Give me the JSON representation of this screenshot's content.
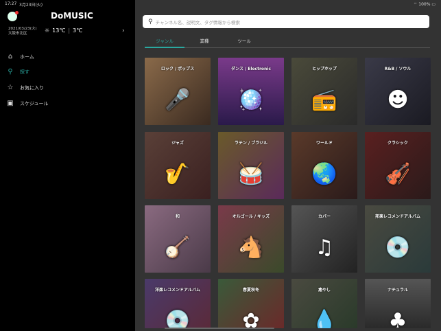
{
  "status": {
    "time": "17:27",
    "date": "3月23日(火)",
    "battery": "100%"
  },
  "app": {
    "title": "DoMUSIC",
    "date": "2021/03/23(火)",
    "location": "大阪市北区",
    "temp_high": "13℃",
    "temp_low": "3℃"
  },
  "nav": [
    {
      "label": "ホーム",
      "icon": "⌂"
    },
    {
      "label": "探す",
      "icon": "⚲"
    },
    {
      "label": "お気に入り",
      "icon": "☆"
    },
    {
      "label": "スケジュール",
      "icon": "▣"
    }
  ],
  "search": {
    "placeholder": "チャンネル名、説明文、タグ情報から検索"
  },
  "tabs": [
    "ジャンル",
    "業種",
    "ツール"
  ],
  "tiles": [
    {
      "label": "ロック / ポップス",
      "icon": "🎤",
      "bg": "linear-gradient(135deg,#8a6a4a,#3a2a20)"
    },
    {
      "label": "ダンス / Electronic",
      "icon": "🪩",
      "bg": "linear-gradient(180deg,#7a3a8a,#2a1a4a)"
    },
    {
      "label": "ヒップホップ",
      "icon": "📻",
      "bg": "linear-gradient(135deg,#4a4a3a,#2a2a2a)"
    },
    {
      "label": "R&B / ソウル",
      "icon": "☻",
      "bg": "linear-gradient(135deg,#3a3a48,#1a1a22)"
    },
    {
      "label": "ジャズ",
      "icon": "🎷",
      "bg": "linear-gradient(135deg,#5a4038,#3a2020)"
    },
    {
      "label": "ラテン / ブラジル",
      "icon": "🥁",
      "bg": "linear-gradient(135deg,#6a5a2a,#5a2a5a)"
    },
    {
      "label": "ワールド",
      "icon": "🌏",
      "bg": "linear-gradient(135deg,#5a3a2a,#2a1a1a)"
    },
    {
      "label": "クラシック",
      "icon": "🎻",
      "bg": "linear-gradient(135deg,#5a2020,#2a1a1a)"
    },
    {
      "label": "和",
      "icon": "🪕",
      "bg": "linear-gradient(135deg,#8a6a80,#4a3a48)"
    },
    {
      "label": "オルゴール / キッズ",
      "icon": "🐴",
      "bg": "linear-gradient(135deg,#7a3a4a,#3a4a2a)"
    },
    {
      "label": "カバー",
      "icon": "♫",
      "bg": "linear-gradient(135deg,#555,#222)"
    },
    {
      "label": "邦楽レコメンドアルバム",
      "icon": "💿",
      "bg": "linear-gradient(135deg,#4a4a40,#2a3a3a)"
    },
    {
      "label": "洋楽レコメンドアルバム",
      "icon": "💿",
      "bg": "linear-gradient(135deg,#4a3a6a,#5a2a3a)"
    },
    {
      "label": "春夏秋冬",
      "icon": "✿",
      "bg": "linear-gradient(135deg,#3a5a3a,#6a2a2a)"
    },
    {
      "label": "癒やし",
      "icon": "💧",
      "bg": "linear-gradient(135deg,#4a4a40,#2a3a2a)"
    },
    {
      "label": "ナチュラル",
      "icon": "♣",
      "bg": "linear-gradient(180deg,#555,#2a2a2a)"
    }
  ]
}
